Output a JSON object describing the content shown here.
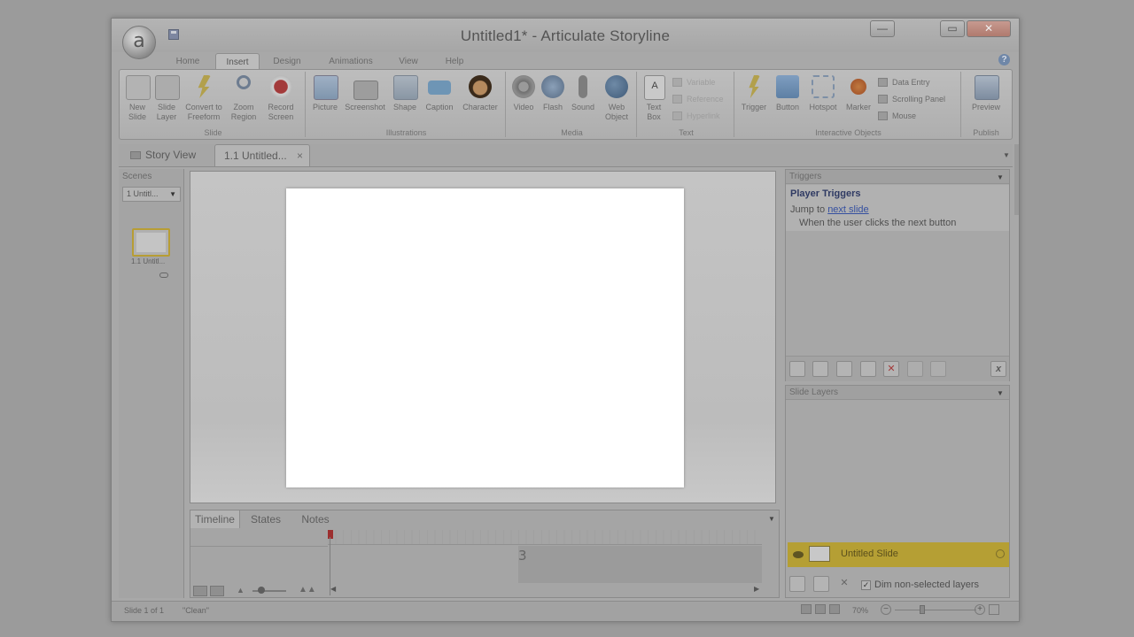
{
  "window": {
    "title": "Untitled1* - Articulate Storyline",
    "app_icon_letter": "a",
    "controls": {
      "minimize": "—",
      "maximize": "▭",
      "close": "✕"
    }
  },
  "ribbon_tabs": [
    "Home",
    "Insert",
    "Design",
    "Animations",
    "View",
    "Help"
  ],
  "active_tab": "Insert",
  "ribbon": {
    "groups": [
      {
        "label": "Slide",
        "buttons": [
          {
            "label": "New\nSlide",
            "icon": "new-slide-icon"
          },
          {
            "label": "Slide\nLayer",
            "icon": "slide-layer-icon"
          },
          {
            "label": "Convert to\nFreeform",
            "icon": "freeform-icon"
          },
          {
            "label": "Zoom\nRegion",
            "icon": "zoom-region-icon"
          },
          {
            "label": "Record\nScreen",
            "icon": "record-screen-icon"
          }
        ]
      },
      {
        "label": "Illustrations",
        "buttons": [
          {
            "label": "Picture",
            "icon": "picture-icon"
          },
          {
            "label": "Screenshot",
            "icon": "screenshot-icon"
          },
          {
            "label": "Shape",
            "icon": "shape-icon"
          },
          {
            "label": "Caption",
            "icon": "caption-icon"
          },
          {
            "label": "Character",
            "icon": "character-icon"
          }
        ]
      },
      {
        "label": "Media",
        "buttons": [
          {
            "label": "Video",
            "icon": "video-icon"
          },
          {
            "label": "Flash",
            "icon": "flash-icon"
          },
          {
            "label": "Sound",
            "icon": "sound-icon"
          },
          {
            "label": "Web\nObject",
            "icon": "web-object-icon"
          }
        ]
      },
      {
        "label": "Text",
        "buttons": [
          {
            "label": "Text\nBox",
            "icon": "text-box-icon"
          }
        ],
        "small_buttons": [
          "Variable",
          "Reference",
          "Hyperlink"
        ]
      },
      {
        "label": "Interactive Objects",
        "buttons": [
          {
            "label": "Trigger",
            "icon": "trigger-icon"
          },
          {
            "label": "Button",
            "icon": "button-icon"
          },
          {
            "label": "Hotspot",
            "icon": "hotspot-icon"
          },
          {
            "label": "Marker",
            "icon": "marker-icon"
          }
        ],
        "small_buttons": [
          "Data Entry",
          "Scrolling Panel",
          "Mouse"
        ]
      },
      {
        "label": "Publish",
        "buttons": [
          {
            "label": "Preview",
            "icon": "preview-icon"
          }
        ]
      }
    ]
  },
  "doc_tabs": {
    "story_view": "Story View",
    "slide_tab": "1.1 Untitled...",
    "close": "×"
  },
  "scenes": {
    "header": "Scenes",
    "selected": "1 Untitl...",
    "thumbnail_label": "1.1 Untitl..."
  },
  "timeline": {
    "tabs": [
      "Timeline",
      "States",
      "Notes"
    ],
    "end_marker": "3"
  },
  "triggers": {
    "header": "Triggers",
    "title": "Player Triggers",
    "action_prefix": "Jump to ",
    "action_link": "next slide",
    "condition": "When the user clicks the next button",
    "delete_icon": "✕",
    "variables_icon": "x"
  },
  "layers": {
    "header": "Slide Layers",
    "base_layer": "Untitled Slide",
    "dim_label": "Dim non-selected layers",
    "dim_checked": "✓"
  },
  "status": {
    "slide": "Slide 1 of 1",
    "theme": "\"Clean\"",
    "zoom": "70%",
    "zoom_out": "−",
    "zoom_in": "+"
  },
  "colors": {
    "dim_overlay": "#9b9b9b",
    "accent_gold": "#b59f34",
    "trigger_title": "#2f3a63",
    "link": "#3550a0"
  }
}
